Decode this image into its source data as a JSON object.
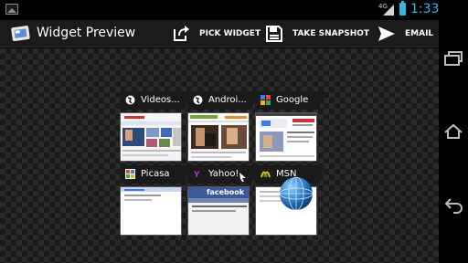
{
  "status_bar": {
    "network": "4G",
    "time": "1:33"
  },
  "action_bar": {
    "title": "Widget Preview",
    "actions": [
      {
        "label": "PICK WIDGET",
        "icon": "share-icon"
      },
      {
        "label": "TAKE SNAPSHOT",
        "icon": "save-icon"
      },
      {
        "label": "EMAIL",
        "icon": "send-icon"
      }
    ]
  },
  "widget": {
    "tiles": [
      {
        "label": "Videos...",
        "icon": "globe-icon"
      },
      {
        "label": "Androi...",
        "icon": "globe-icon"
      },
      {
        "label": "Google",
        "icon": "google-icon"
      },
      {
        "label": "Picasa",
        "icon": "picasa-icon"
      },
      {
        "label": "Yahoo!",
        "icon": "yahoo-icon"
      },
      {
        "label": "MSN",
        "icon": "msn-icon"
      }
    ],
    "thumbnail_texts": {
      "facebook": "facebook"
    }
  },
  "colors": {
    "accent": "#33b5e5",
    "action_bar": "#1b1b1b"
  },
  "nav": [
    "recent-apps-icon",
    "home-icon",
    "back-icon"
  ]
}
